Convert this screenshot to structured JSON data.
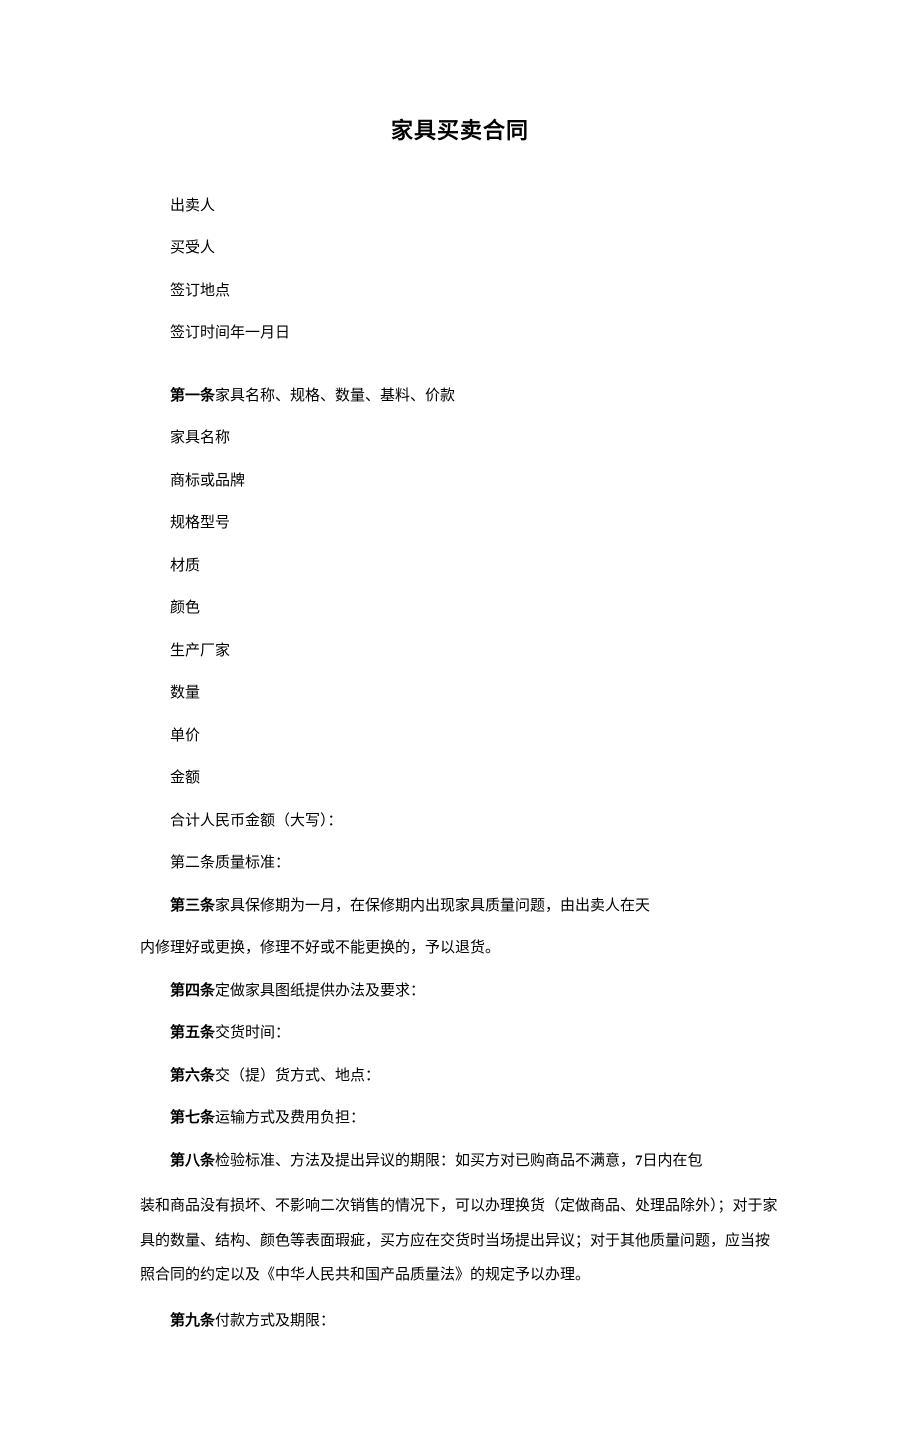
{
  "title": "家具买卖合同",
  "fields": {
    "seller": "出卖人",
    "buyer": "买受人",
    "place": "签订地点",
    "time": "签订时间年一月日"
  },
  "art1": {
    "label": "第一条",
    "text": "家具名称、规格、数量、基料、价款",
    "items": {
      "name": "家具名称",
      "brand": "商标或品牌",
      "model": "规格型号",
      "material": "材质",
      "color": "颜色",
      "mfr": "生产厂家",
      "qty": "数量",
      "unit": "单价",
      "amount": "金额",
      "total": "合计人民币金额（大写）："
    }
  },
  "art2": "第二条质量标准：",
  "art3": {
    "label": "第三条",
    "text": "家具保修期为一月，在保修期内出现家具质量问题，由出卖人在天"
  },
  "art3_cont": "内修理好或更换，修理不好或不能更换的，予以退货。",
  "art4": {
    "label": "第四条",
    "text": "定做家具图纸提供办法及要求："
  },
  "art5": {
    "label": "第五条",
    "text": "交货时间："
  },
  "art6": {
    "label": "第六条",
    "text": "交（提）货方式、地点："
  },
  "art7": {
    "label": "第七条",
    "text": "运输方式及费用负担："
  },
  "art8": {
    "label": "第八条",
    "text1": "检验标准、方法及提出异议的期限：如买方对已购商品不满意，",
    "seven": "7",
    "text2": "日内在包"
  },
  "art8_cont": "装和商品没有损坏、不影响二次销售的情况下，可以办理换货（定做商品、处理品除外）；对于家具的数量、结构、颜色等表面瑕疵，买方应在交货时当场提出异议；对于其他质量问题，应当按照合同的约定以及《中华人民共和国产品质量法》的规定予以办理。",
  "art9": {
    "label": "第九条",
    "text": "付款方式及期限："
  }
}
